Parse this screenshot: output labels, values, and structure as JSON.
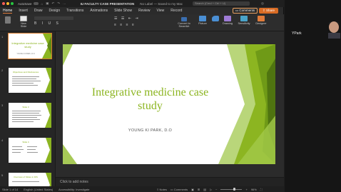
{
  "titlebar": {
    "autosave_label": "AutoSave",
    "document_title": "IU FACULTY CASE PRESENTATION",
    "sensitivity_status": "No Label — Saved to my Mac",
    "search_placeholder": "Search (Cmd + Ctrl + U)"
  },
  "menu": {
    "tabs": [
      "Home",
      "Insert",
      "Draw",
      "Design",
      "Transitions",
      "Animations",
      "Slide Show",
      "Review",
      "View",
      "Record"
    ],
    "active_tab": "Home",
    "comments_label": "Comments",
    "share_label": "Share"
  },
  "ribbon": {
    "new_slide_label": "New Slide",
    "convert_label": "Convert to SmartArt",
    "picture_label": "Picture",
    "drawing_label": "Drawing",
    "sensitivity_label": "Sensitivity",
    "designer_label": "Designer"
  },
  "thumbnails": [
    {
      "number": "1",
      "title": "Integrative medicine case study",
      "subtitle": "YOUNG KI PARK, D.O",
      "selected": true
    },
    {
      "number": "2",
      "title": "Objectives and Disclosures",
      "selected": false
    },
    {
      "number": "3",
      "title": "Slide 3",
      "selected": false
    },
    {
      "number": "4",
      "title": "Slide 4",
      "selected": false
    },
    {
      "number": "5",
      "title": "Overview of Slides in RIS",
      "selected": false
    }
  ],
  "slide": {
    "title": "Integrative medicine case study",
    "author": "YOUNG KI PARK, D.O",
    "accent_color": "#8cb521"
  },
  "notes_placeholder": "Click to add notes",
  "statusbar": {
    "slide_counter": "Slide 1 of 14",
    "language": "English (United States)",
    "accessibility": "Accessibility: Investigate",
    "notes_label": "Notes",
    "comments_label": "Comments",
    "zoom": "96%"
  },
  "video": {
    "participant_name": "YPark"
  }
}
